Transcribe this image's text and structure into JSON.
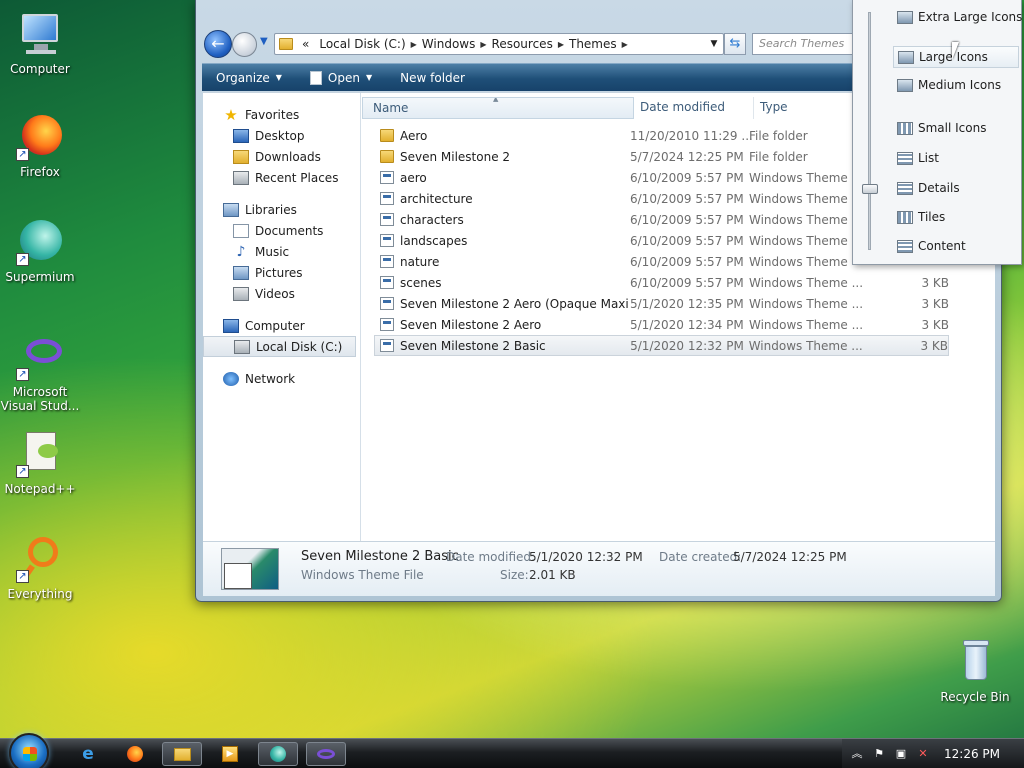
{
  "desktop_icons": [
    {
      "label": "Computer"
    },
    {
      "label": "Firefox"
    },
    {
      "label": "Supermium"
    },
    {
      "label": "Microsoft Visual Stud..."
    },
    {
      "label": "Notepad++"
    },
    {
      "label": "Everything"
    },
    {
      "label": "Recycle Bin"
    }
  ],
  "address": {
    "prefix": "«",
    "segments": [
      "Local Disk (C:)",
      "Windows",
      "Resources",
      "Themes"
    ]
  },
  "search": {
    "placeholder": "Search Themes"
  },
  "toolbar": {
    "organize": "Organize",
    "open": "Open",
    "new_folder": "New folder"
  },
  "nav": {
    "favorites": "Favorites",
    "desktop": "Desktop",
    "downloads": "Downloads",
    "recent_places": "Recent Places",
    "libraries": "Libraries",
    "documents": "Documents",
    "music": "Music",
    "pictures": "Pictures",
    "videos": "Videos",
    "computer": "Computer",
    "local_disk": "Local Disk (C:)",
    "network": "Network"
  },
  "columns": {
    "name": "Name",
    "date": "Date modified",
    "type": "Type"
  },
  "files": [
    {
      "name": "Aero",
      "date": "11/20/2010 11:29 ...",
      "type": "File folder",
      "size": "",
      "kind": "folder"
    },
    {
      "name": "Seven Milestone 2",
      "date": "5/7/2024 12:25 PM",
      "type": "File folder",
      "size": "",
      "kind": "folder"
    },
    {
      "name": "aero",
      "date": "6/10/2009 5:57 PM",
      "type": "Windows Theme",
      "size": "",
      "kind": "theme"
    },
    {
      "name": "architecture",
      "date": "6/10/2009 5:57 PM",
      "type": "Windows Theme",
      "size": "",
      "kind": "theme"
    },
    {
      "name": "characters",
      "date": "6/10/2009 5:57 PM",
      "type": "Windows Theme",
      "size": "",
      "kind": "theme"
    },
    {
      "name": "landscapes",
      "date": "6/10/2009 5:57 PM",
      "type": "Windows Theme",
      "size": "",
      "kind": "theme"
    },
    {
      "name": "nature",
      "date": "6/10/2009 5:57 PM",
      "type": "Windows Theme",
      "size": "",
      "kind": "theme"
    },
    {
      "name": "scenes",
      "date": "6/10/2009 5:57 PM",
      "type": "Windows Theme ...",
      "size": "3 KB",
      "kind": "theme"
    },
    {
      "name": "Seven Milestone 2 Aero (Opaque Maximi...",
      "date": "5/1/2020 12:35 PM",
      "type": "Windows Theme ...",
      "size": "3 KB",
      "kind": "theme"
    },
    {
      "name": "Seven Milestone 2 Aero",
      "date": "5/1/2020 12:34 PM",
      "type": "Windows Theme ...",
      "size": "3 KB",
      "kind": "theme"
    },
    {
      "name": "Seven Milestone 2 Basic",
      "date": "5/1/2020 12:32 PM",
      "type": "Windows Theme ...",
      "size": "3 KB",
      "kind": "theme",
      "selected": true
    }
  ],
  "details": {
    "name": "Seven Milestone 2 Basic",
    "type": "Windows Theme File",
    "date_modified_label": "Date modified:",
    "date_modified": "5/1/2020 12:32 PM",
    "date_created_label": "Date created:",
    "date_created": "5/7/2024 12:25 PM",
    "size_label": "Size:",
    "size": "2.01 KB"
  },
  "view_menu": {
    "items": [
      "Extra Large Icons",
      "Large Icons",
      "Medium Icons",
      "Small Icons",
      "List",
      "Details",
      "Tiles",
      "Content"
    ],
    "hovered": "Large Icons",
    "slider_level": "Details"
  },
  "taskbar": {
    "clock": "12:26 PM"
  },
  "colors": {
    "toolbar": "#1f4f78",
    "accent": "#1f5fc1"
  }
}
